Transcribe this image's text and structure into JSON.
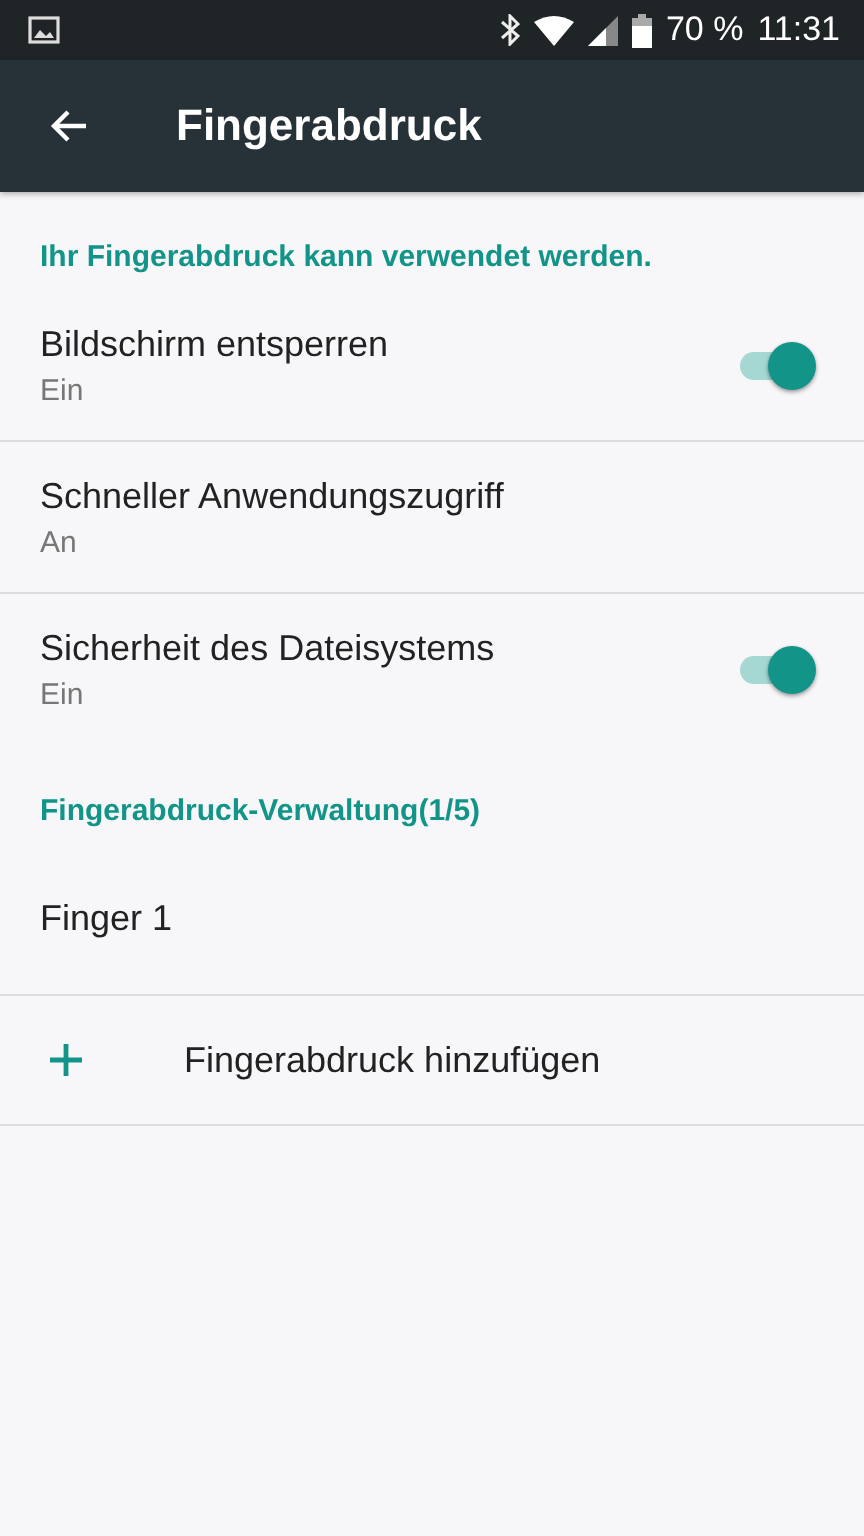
{
  "status_bar": {
    "battery": "70 %",
    "time": "11:31"
  },
  "app_bar": {
    "title": "Fingerabdruck"
  },
  "sections": [
    {
      "header": "Ihr Fingerabdruck kann verwendet werden.",
      "items": [
        {
          "kind": "switch",
          "title": "Bildschirm entsperren",
          "summary": "Ein",
          "on": true
        },
        {
          "kind": "plain",
          "title": "Schneller Anwendungszugriff",
          "summary": "An"
        },
        {
          "kind": "switch",
          "title": "Sicherheit des Dateisystems",
          "summary": "Ein",
          "on": true
        }
      ]
    },
    {
      "header": "Fingerabdruck-Verwaltung(1/5)",
      "items": [
        {
          "kind": "plain",
          "title": "Finger 1"
        },
        {
          "kind": "add",
          "title": "Fingerabdruck hinzufügen"
        }
      ]
    }
  ]
}
